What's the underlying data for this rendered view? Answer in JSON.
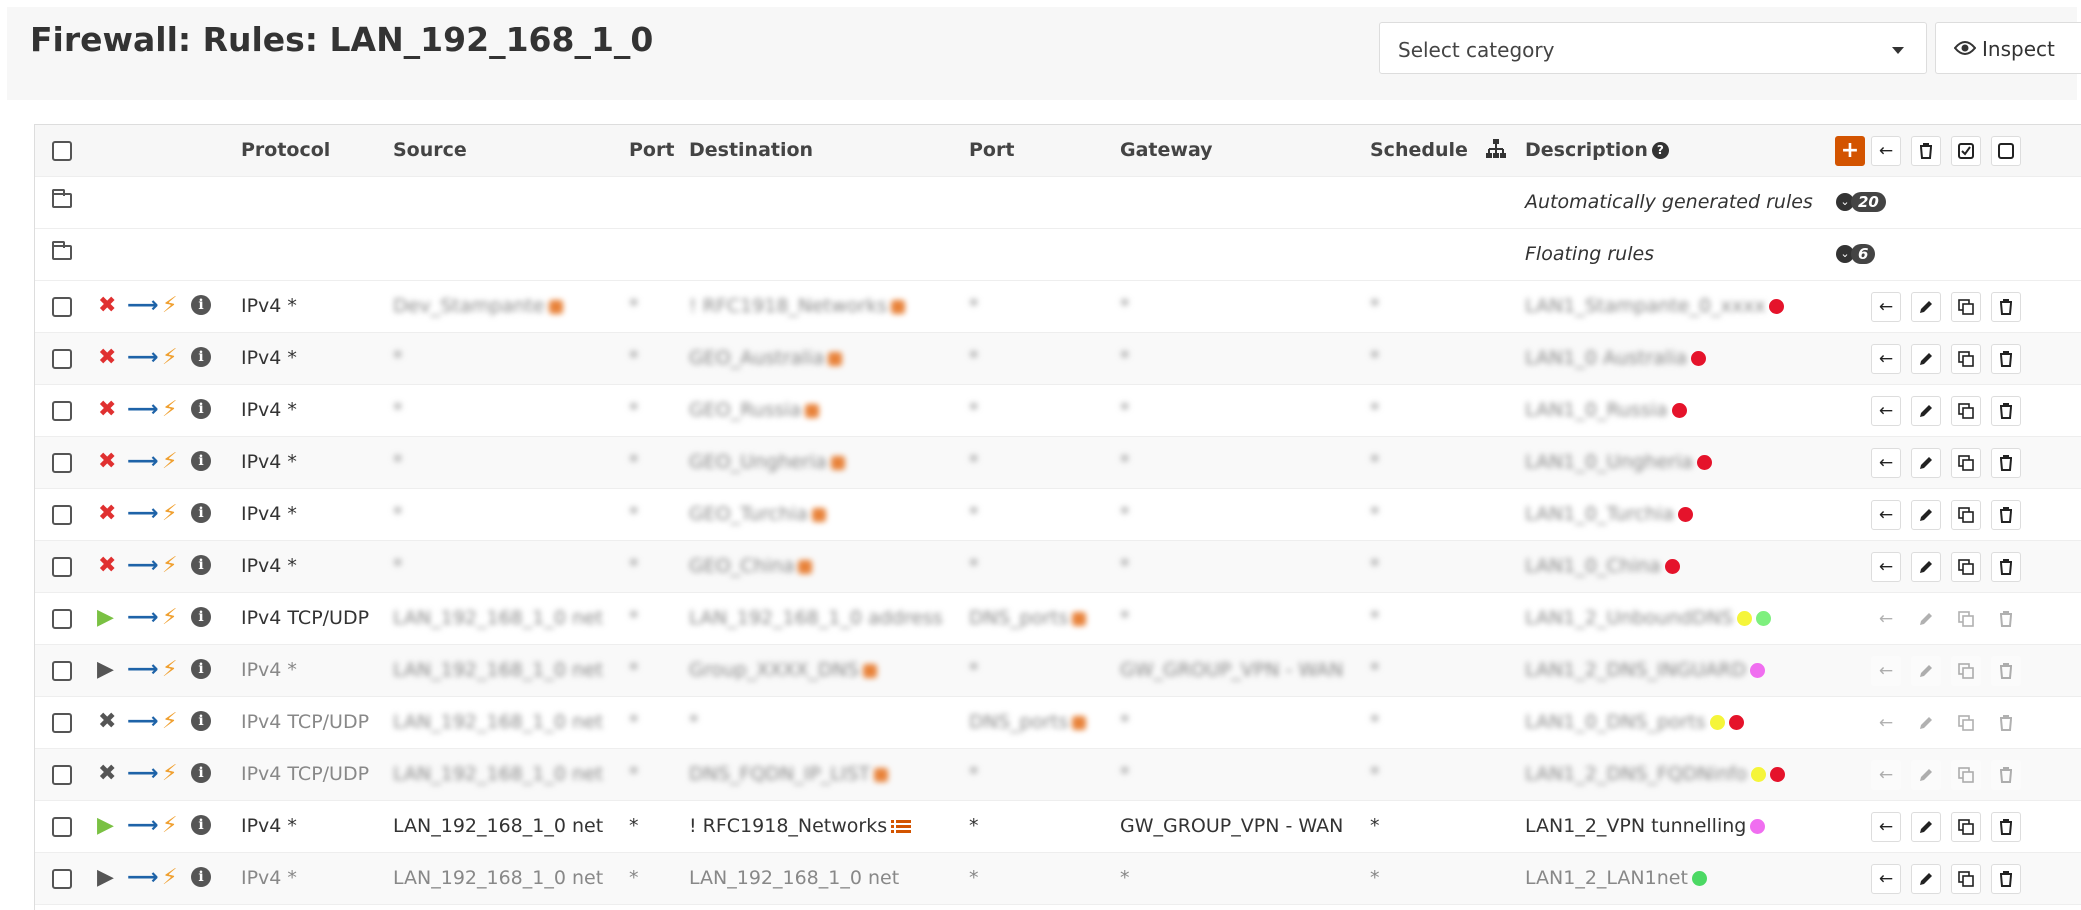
{
  "page": {
    "title": "Firewall: Rules: LAN_192_168_1_0",
    "category_select": {
      "value": "Select category"
    },
    "inspect_label": "Inspect"
  },
  "table": {
    "headers": {
      "protocol": "Protocol",
      "source": "Source",
      "port": "Port",
      "destination": "Destination",
      "dest_port": "Port",
      "gateway": "Gateway",
      "schedule": "Schedule",
      "description": "Description"
    },
    "groups": [
      {
        "description": "Automatically generated rules",
        "count": "20"
      },
      {
        "description": "Floating rules",
        "count": "6"
      }
    ],
    "rules": [
      {
        "action": "block",
        "protocol": "IPv4 *",
        "source": "Dev_Stampante",
        "source_badge": "alias",
        "port": "*",
        "destination": "! RFC1918_Networks",
        "dest_badge": "alias",
        "dest_port": "*",
        "gateway": "*",
        "schedule": "*",
        "description": "LAN1_Stampante_0_xxxx",
        "desc_dots": [
          "#e5132b"
        ],
        "blurred": true,
        "dim": false
      },
      {
        "action": "block",
        "protocol": "IPv4 *",
        "source": "*",
        "source_badge": "",
        "port": "*",
        "destination": "GEO_Australia",
        "dest_badge": "alias",
        "dest_port": "*",
        "gateway": "*",
        "schedule": "*",
        "description": "LAN1_0 Australia",
        "desc_dots": [
          "#e5132b"
        ],
        "blurred": true,
        "dim": false
      },
      {
        "action": "block",
        "protocol": "IPv4 *",
        "source": "*",
        "source_badge": "",
        "port": "*",
        "destination": "GEO_Russia",
        "dest_badge": "alias",
        "dest_port": "*",
        "gateway": "*",
        "schedule": "*",
        "description": "LAN1_0_Russia",
        "desc_dots": [
          "#e5132b"
        ],
        "blurred": true,
        "dim": false
      },
      {
        "action": "block",
        "protocol": "IPv4 *",
        "source": "*",
        "source_badge": "",
        "port": "*",
        "destination": "GEO_Ungheria",
        "dest_badge": "alias",
        "dest_port": "*",
        "gateway": "*",
        "schedule": "*",
        "description": "LAN1_0_Ungheria",
        "desc_dots": [
          "#e5132b"
        ],
        "blurred": true,
        "dim": false
      },
      {
        "action": "block",
        "protocol": "IPv4 *",
        "source": "*",
        "source_badge": "",
        "port": "*",
        "destination": "GEO_Turchia",
        "dest_badge": "alias",
        "dest_port": "*",
        "gateway": "*",
        "schedule": "*",
        "description": "LAN1_0_Turchia",
        "desc_dots": [
          "#e5132b"
        ],
        "blurred": true,
        "dim": false
      },
      {
        "action": "block",
        "protocol": "IPv4 *",
        "source": "*",
        "source_badge": "",
        "port": "*",
        "destination": "GEO_China",
        "dest_badge": "alias",
        "dest_port": "*",
        "gateway": "*",
        "schedule": "*",
        "description": "LAN1_0_China",
        "desc_dots": [
          "#e5132b"
        ],
        "blurred": true,
        "dim": false
      },
      {
        "action": "pass",
        "protocol": "IPv4 TCP/UDP",
        "source": "LAN_192_168_1_0 net",
        "source_badge": "",
        "port": "*",
        "destination": "LAN_192_168_1_0 address",
        "dest_badge": "",
        "dest_port": "DNS_ports",
        "dest_port_badge": "alias",
        "gateway": "*",
        "schedule": "*",
        "description": "LAN1_2_UnboundDNS",
        "desc_dots": [
          "#f5f53a",
          "#7ef07e"
        ],
        "blurred": true,
        "dim": false,
        "actions_faded": true
      },
      {
        "action": "pass-disabled",
        "protocol": "IPv4 *",
        "source": "LAN_192_168_1_0 net",
        "source_badge": "",
        "port": "*",
        "destination": "Group_XXXX_DNS",
        "dest_badge": "alias",
        "dest_port": "*",
        "gateway": "GW_GROUP_VPN - WAN",
        "schedule": "*",
        "description": "LAN1_2_DNS_INGUARD",
        "desc_dots": [
          "#f06ef0"
        ],
        "blurred": true,
        "dim": true,
        "actions_faded": true
      },
      {
        "action": "block-disabled",
        "protocol": "IPv4 TCP/UDP",
        "source": "LAN_192_168_1_0 net",
        "source_badge": "",
        "port": "*",
        "destination": "*",
        "dest_badge": "",
        "dest_port": "DNS_ports",
        "dest_port_badge": "alias",
        "gateway": "*",
        "schedule": "*",
        "description": "LAN1_0_DNS_ports",
        "desc_dots": [
          "#f5f53a",
          "#e5132b"
        ],
        "blurred": true,
        "dim": true,
        "actions_faded": true
      },
      {
        "action": "block-disabled",
        "protocol": "IPv4 TCP/UDP",
        "source": "LAN_192_168_1_0 net",
        "source_badge": "",
        "port": "*",
        "destination": "DNS_FQDN_IP_LIST",
        "dest_badge": "alias",
        "dest_port": "*",
        "gateway": "*",
        "schedule": "*",
        "description": "LAN1_2_DNS_FQDNinfo",
        "desc_dots": [
          "#f5f53a",
          "#e5132b"
        ],
        "blurred": true,
        "dim": true,
        "actions_faded": true
      },
      {
        "action": "pass",
        "protocol": "IPv4 *",
        "source": "LAN_192_168_1_0 net",
        "source_badge": "",
        "port": "*",
        "destination": "! RFC1918_Networks",
        "dest_badge": "list",
        "dest_port": "*",
        "gateway": "GW_GROUP_VPN - WAN",
        "schedule": "*",
        "description": "LAN1_2_VPN tunnelling",
        "desc_dots": [
          "#f06ef0"
        ],
        "blurred": false,
        "dim": false
      },
      {
        "action": "pass-disabled",
        "protocol": "IPv4 *",
        "source": "LAN_192_168_1_0 net",
        "source_badge": "",
        "port": "*",
        "destination": "LAN_192_168_1_0 net",
        "dest_badge": "",
        "dest_port": "*",
        "gateway": "*",
        "schedule": "*",
        "description": "LAN1_2_LAN1net",
        "desc_dots": [
          "#4cd964"
        ],
        "blurred": false,
        "dim": true
      }
    ]
  },
  "colors": {
    "accent_orange": "#d35400",
    "block_red": "#e03030",
    "pass_green": "#7ac143",
    "arrow_blue": "#1e63a8",
    "bolt_orange": "#f0a030",
    "alias_badge": "#e8823a"
  },
  "icons": {
    "add": "plus-icon",
    "move": "arrow-left-icon",
    "delete": "trash-icon",
    "enable": "check-square-icon",
    "disable": "square-icon",
    "edit": "pencil-icon",
    "copy": "copy-icon",
    "info": "info-icon",
    "tree": "sitemap-icon",
    "help": "question-circle-icon"
  }
}
